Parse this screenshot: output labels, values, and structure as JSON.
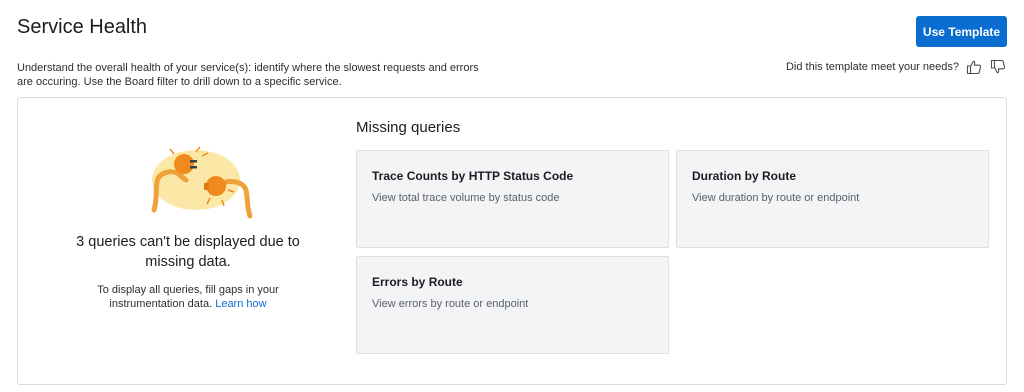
{
  "header": {
    "title": "Service Health",
    "use_template_label": "Use Template",
    "description": "Understand the overall health of your service(s): identify where the slowest requests and errors are occuring. Use the Board filter to drill down to a specific service."
  },
  "feedback": {
    "question": "Did this template meet your needs?",
    "thumbs_up_icon": "thumbs-up-icon",
    "thumbs_down_icon": "thumbs-down-icon"
  },
  "missing": {
    "illustration": "unplugged-cable-illustration",
    "title": "3 queries can't be displayed due to missing data.",
    "help_text": "To display all queries, fill gaps in your instrumentation data.",
    "learn_link": "Learn how"
  },
  "queries": {
    "heading": "Missing queries",
    "cards": [
      {
        "title": "Trace Counts by HTTP Status Code",
        "description": "View total trace volume by status code"
      },
      {
        "title": "Duration by Route",
        "description": "View duration by route or endpoint"
      },
      {
        "title": "Errors by Route",
        "description": "View errors by route or endpoint"
      }
    ]
  },
  "colors": {
    "accent": "#0a6ed1",
    "card_bg": "#f3f4f6",
    "illustration_blob": "#fbe7a6",
    "plug_orange": "#f08a1c"
  }
}
